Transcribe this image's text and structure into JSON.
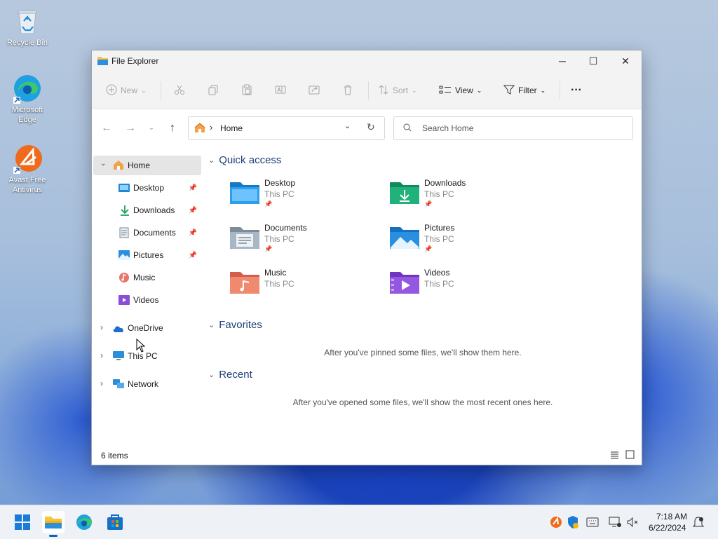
{
  "desktop": {
    "icons": [
      {
        "label": "Recycle Bin",
        "icon": "recycle-bin-icon"
      },
      {
        "label": "Microsoft Edge",
        "icon": "edge-icon"
      },
      {
        "label": "Avast Free Antivirus",
        "icon": "avast-icon"
      }
    ]
  },
  "window": {
    "title": "File Explorer",
    "controls": {
      "minimize": "─",
      "maximize": "☐",
      "close": "✕"
    }
  },
  "toolbar": {
    "new_label": "New",
    "sort_label": "Sort",
    "view_label": "View",
    "filter_label": "Filter",
    "more_label": "···"
  },
  "address": {
    "path": "Home",
    "separator": "›"
  },
  "search": {
    "placeholder": "Search Home"
  },
  "nav": {
    "home": "Home",
    "pinned": [
      {
        "label": "Desktop",
        "icon": "desktop-folder-icon",
        "pinned": true
      },
      {
        "label": "Downloads",
        "icon": "download-icon",
        "pinned": true
      },
      {
        "label": "Documents",
        "icon": "documents-icon",
        "pinned": true
      },
      {
        "label": "Pictures",
        "icon": "pictures-icon",
        "pinned": true
      },
      {
        "label": "Music",
        "icon": "music-icon",
        "pinned": false
      },
      {
        "label": "Videos",
        "icon": "videos-icon",
        "pinned": false
      }
    ],
    "onedrive": "OneDrive",
    "thispc": "This PC",
    "network": "Network"
  },
  "content": {
    "quick_access_title": "Quick access",
    "quick_access": [
      {
        "name": "Desktop",
        "location": "This PC",
        "pinned": true
      },
      {
        "name": "Downloads",
        "location": "This PC",
        "pinned": true
      },
      {
        "name": "Documents",
        "location": "This PC",
        "pinned": true
      },
      {
        "name": "Pictures",
        "location": "This PC",
        "pinned": true
      },
      {
        "name": "Music",
        "location": "This PC",
        "pinned": false
      },
      {
        "name": "Videos",
        "location": "This PC",
        "pinned": false
      }
    ],
    "favorites_title": "Favorites",
    "favorites_empty": "After you've pinned some files, we'll show them here.",
    "recent_title": "Recent",
    "recent_empty": "After you've opened some files, we'll show the most recent ones here."
  },
  "status": {
    "items": "6 items"
  },
  "taskbar": {
    "time": "7:18 AM",
    "date": "6/22/2024"
  },
  "colors": {
    "accent": "#0067c0",
    "section_title": "#1f3f7a",
    "selected_bg": "#e5e5e5"
  }
}
